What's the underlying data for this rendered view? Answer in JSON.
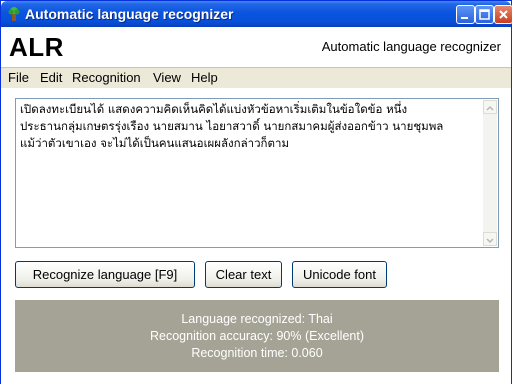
{
  "window": {
    "title": "Automatic language recognizer"
  },
  "header": {
    "logo": "ALR",
    "subtitle": "Automatic language recognizer"
  },
  "menu": [
    "File",
    "Edit",
    "Recognition",
    "View",
    "Help"
  ],
  "editor": {
    "lines": [
      "เปิดลงทะเบียนได้ แสดงความคิดเห็นคิดได้แบ่งหัวข้อหาเริ่มเติมในข้อใดข้อ หนึ่ง",
      "ประธานกลุ่มเกษตรรุ่งเรือง นายสมาน ไอยาสวาดิ์ นายกสมาคมผู้ส่งออกข้าว นายชุมพล",
      "แม้ว่าตัวเขาเอง จะไม่ได้เป็นคนแสนอเผผลังกล่าวก็ตาม"
    ]
  },
  "buttons": {
    "recognize": "Recognize language   [F9]",
    "clear": "Clear text",
    "unicode": "Unicode font"
  },
  "results": {
    "language": "Language recognized: Thai",
    "accuracy": "Recognition accuracy: 90% (Excellent)",
    "time": "Recognition time: 0.060"
  },
  "colors": {
    "titlebar": "#0a54e0",
    "result_panel": "#a4a395"
  }
}
